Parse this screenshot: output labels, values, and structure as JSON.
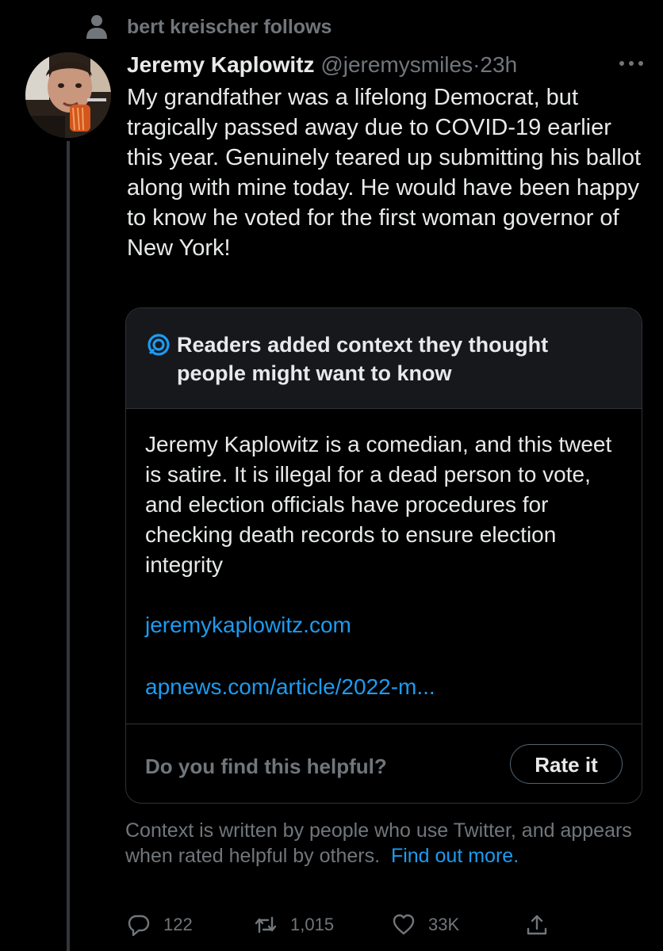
{
  "social_context": {
    "text": "bert kreischer follows",
    "icon": "person-icon"
  },
  "tweet": {
    "author_name": "Jeremy Kaplowitz",
    "handle": "@jeremysmiles",
    "separator": "·",
    "time": "23h",
    "text": "My grandfather was a lifelong Democrat, but tragically passed away due to COVID-19 earlier this year. Genuinely teared up submitting his ballot along with mine today. He would have been happy to know he voted for the first woman governor of New York!"
  },
  "note": {
    "title": "Readers added context they thought people might want to know",
    "body": "Jeremy Kaplowitz is a comedian, and this tweet is satire. It is illegal for a dead person to vote, and election officials have procedures for checking death records to ensure election integrity",
    "links": [
      "jeremykaplowitz.com",
      "apnews.com/article/2022-m..."
    ],
    "helpful_prompt": "Do you find this helpful?",
    "rate_button": "Rate it"
  },
  "disclaimer": {
    "text": "Context is written by people who use Twitter, and appears when rated helpful by others.",
    "link": "Find out more."
  },
  "actions": {
    "replies": "122",
    "retweets": "1,015",
    "likes": "33K"
  },
  "colors": {
    "background": "#000000",
    "accent": "#1d9bf0",
    "muted": "#71767b",
    "text": "#e7e9ea"
  }
}
